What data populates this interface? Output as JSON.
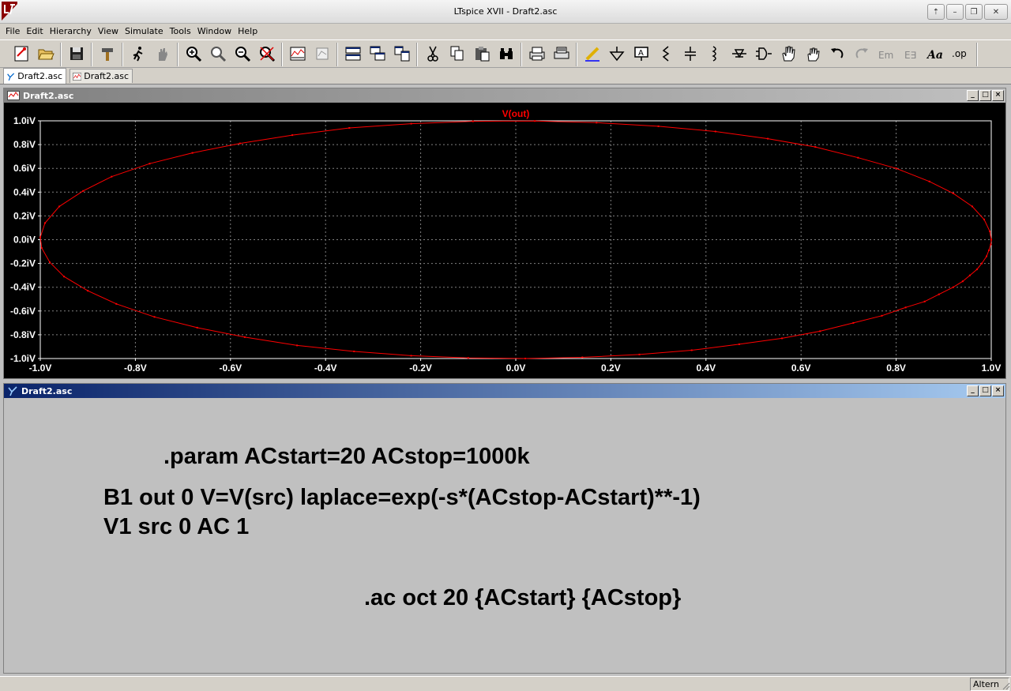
{
  "window": {
    "title": "LTspice XVII - Draft2.asc"
  },
  "menu": [
    "File",
    "Edit",
    "Hierarchy",
    "View",
    "Simulate",
    "Tools",
    "Window",
    "Help"
  ],
  "tabs": [
    {
      "label": "Draft2.asc",
      "icon": "schematic-icon",
      "active": true
    },
    {
      "label": "Draft2.asc",
      "icon": "waveform-icon",
      "active": false
    }
  ],
  "waveform_window": {
    "title": "Draft2.asc"
  },
  "schematic_window": {
    "title": "Draft2.asc"
  },
  "schematic_text": {
    "param": ".param ACstart=20 ACstop=1000k",
    "b1": "B1 out 0 V=V(src) laplace=exp(-s*(ACstop-ACstart)**-1)",
    "v1": "V1 src 0 AC 1",
    "ac": ".ac oct 20 {ACstart} {ACstop}"
  },
  "status": {
    "text": "Altern"
  },
  "colors": {
    "trace": "#ff0000",
    "plot_bg": "#000000",
    "grid": "#808080",
    "axis_text": "#ffffff"
  },
  "chart_data": {
    "type": "line",
    "title": "V(out)",
    "xlabel": "",
    "ylabel": "",
    "xlim": [
      -1.0,
      1.0
    ],
    "ylim": [
      -1.0,
      1.0
    ],
    "xticks": [
      "-1.0V",
      "-0.8V",
      "-0.6V",
      "-0.4V",
      "-0.2V",
      "0.0V",
      "0.2V",
      "0.4V",
      "0.6V",
      "0.8V",
      "1.0V"
    ],
    "yticks": [
      "1.0iV",
      "0.8iV",
      "0.6iV",
      "0.4iV",
      "0.2iV",
      "0.0iV",
      "-0.2iV",
      "-0.4iV",
      "-0.6iV",
      "-0.8iV",
      "-1.0iV"
    ],
    "grid": true,
    "legend": "top-center",
    "series": [
      {
        "name": "V(out)",
        "x": [
          1.0,
          0.999,
          0.995,
          0.99,
          0.98,
          0.97,
          0.955,
          0.94,
          0.92,
          0.89,
          0.86,
          0.82,
          0.77,
          0.71,
          0.64,
          0.56,
          0.47,
          0.37,
          0.26,
          0.14,
          0.02,
          -0.1,
          -0.22,
          -0.34,
          -0.46,
          -0.57,
          -0.67,
          -0.76,
          -0.84,
          -0.9,
          -0.95,
          -0.98,
          -0.997,
          -1.0,
          -0.99,
          -0.96,
          -0.91,
          -0.85,
          -0.77,
          -0.68,
          -0.58,
          -0.47,
          -0.35,
          -0.22,
          -0.09,
          0.04,
          0.17,
          0.3,
          0.42,
          0.53,
          0.63,
          0.72,
          0.8,
          0.87,
          0.92,
          0.96,
          0.985,
          0.997
        ],
        "y": [
          0.0,
          -0.04,
          -0.09,
          -0.14,
          -0.2,
          -0.25,
          -0.3,
          -0.35,
          -0.4,
          -0.46,
          -0.52,
          -0.57,
          -0.64,
          -0.7,
          -0.77,
          -0.83,
          -0.88,
          -0.93,
          -0.966,
          -0.99,
          -1.0,
          -0.995,
          -0.976,
          -0.94,
          -0.89,
          -0.82,
          -0.74,
          -0.65,
          -0.54,
          -0.43,
          -0.31,
          -0.19,
          -0.07,
          0.02,
          0.14,
          0.28,
          0.41,
          0.53,
          0.64,
          0.73,
          0.81,
          0.88,
          0.94,
          0.976,
          0.996,
          0.999,
          0.985,
          0.954,
          0.91,
          0.85,
          0.78,
          0.69,
          0.6,
          0.49,
          0.39,
          0.28,
          0.17,
          0.07
        ]
      }
    ]
  }
}
